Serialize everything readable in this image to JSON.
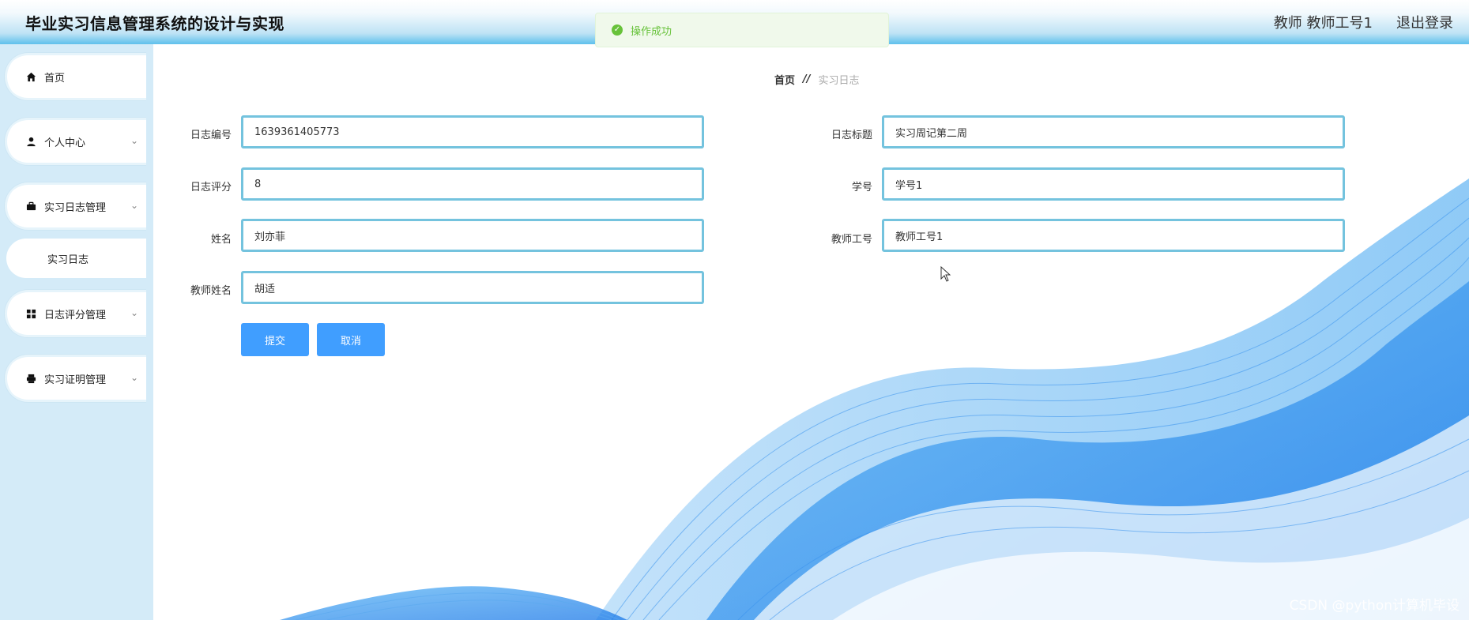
{
  "header": {
    "title": "毕业实习信息管理系统的设计与实现",
    "user": "教师 教师工号1",
    "logout": "退出登录"
  },
  "toast": {
    "text": "操作成功"
  },
  "sidebar": {
    "items": [
      {
        "label": "首页"
      },
      {
        "label": "个人中心"
      },
      {
        "label": "实习日志管理"
      },
      {
        "label": "日志评分管理"
      },
      {
        "label": "实习证明管理"
      }
    ],
    "submenu": {
      "label": "实习日志"
    }
  },
  "breadcrumb": {
    "home": "首页",
    "separator": "//",
    "current": "实习日志"
  },
  "form": {
    "log_id": {
      "label": "日志编号",
      "value": "1639361405773"
    },
    "log_title": {
      "label": "日志标题",
      "value": "实习周记第二周"
    },
    "log_score": {
      "label": "日志评分",
      "value": "8"
    },
    "student_id": {
      "label": "学号",
      "value": "学号1"
    },
    "name": {
      "label": "姓名",
      "value": "刘亦菲"
    },
    "teacher_id": {
      "label": "教师工号",
      "value": "教师工号1"
    },
    "teacher_name": {
      "label": "教师姓名",
      "value": "胡适"
    },
    "submit": "提交",
    "cancel": "取消"
  },
  "watermark": "CSDN @python计算机毕设",
  "colors": {
    "accent": "#409eff",
    "input_border": "#74c3de",
    "success": "#67c23a",
    "sidebar_bg": "#d4ebf8"
  }
}
